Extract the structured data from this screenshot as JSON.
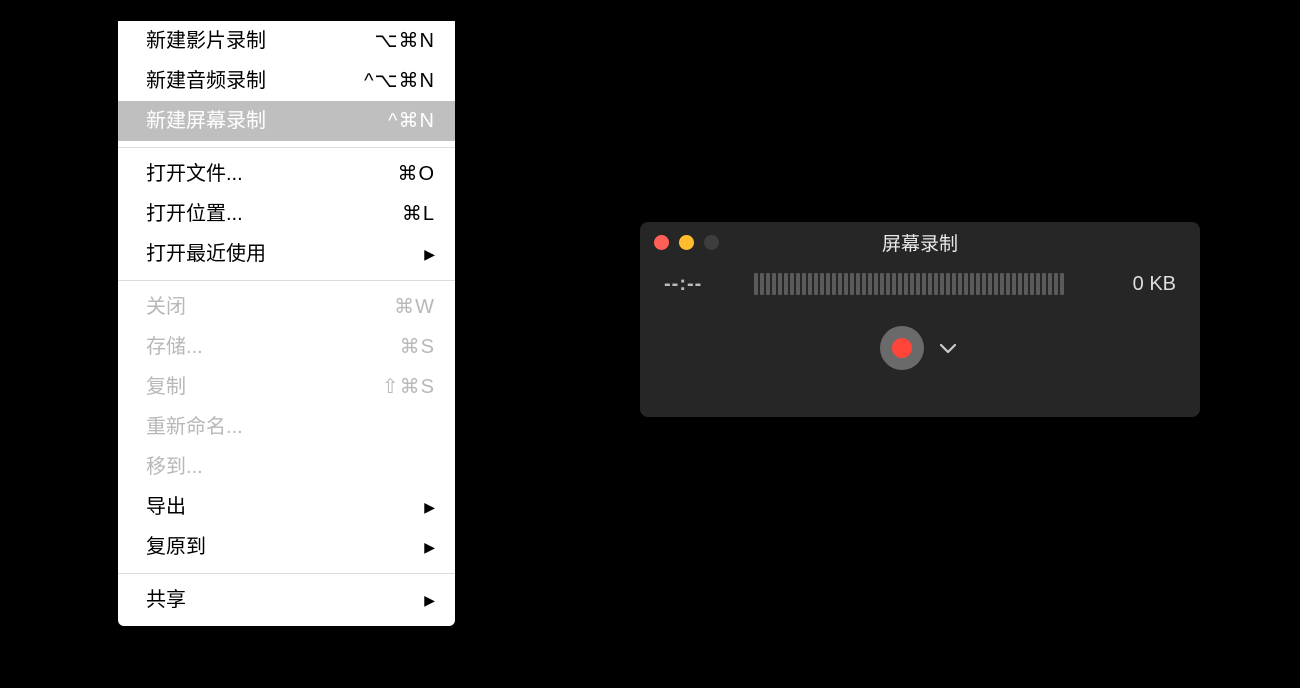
{
  "menu": {
    "group1": [
      {
        "label": "新建影片录制",
        "shortcut": "⌥⌘N"
      },
      {
        "label": "新建音频录制",
        "shortcut": "^⌥⌘N"
      },
      {
        "label": "新建屏幕录制",
        "shortcut": "^⌘N",
        "highlight": true
      }
    ],
    "group2": [
      {
        "label": "打开文件...",
        "shortcut": "⌘O"
      },
      {
        "label": "打开位置...",
        "shortcut": "⌘L"
      },
      {
        "label": "打开最近使用",
        "submenu": true
      }
    ],
    "group3": [
      {
        "label": "关闭",
        "shortcut": "⌘W",
        "disabled": true
      },
      {
        "label": "存储...",
        "shortcut": "⌘S",
        "disabled": true
      },
      {
        "label": "复制",
        "shortcut": "⇧⌘S",
        "disabled": true
      },
      {
        "label": "重新命名...",
        "disabled": true
      },
      {
        "label": "移到...",
        "disabled": true
      },
      {
        "label": "导出",
        "submenu": true
      },
      {
        "label": "复原到",
        "submenu": true
      }
    ],
    "group4": [
      {
        "label": "共享",
        "submenu": true
      }
    ]
  },
  "panel": {
    "title": "屏幕录制",
    "timecode": "--:--",
    "filesize": "0 KB",
    "meter_segments": 52
  }
}
